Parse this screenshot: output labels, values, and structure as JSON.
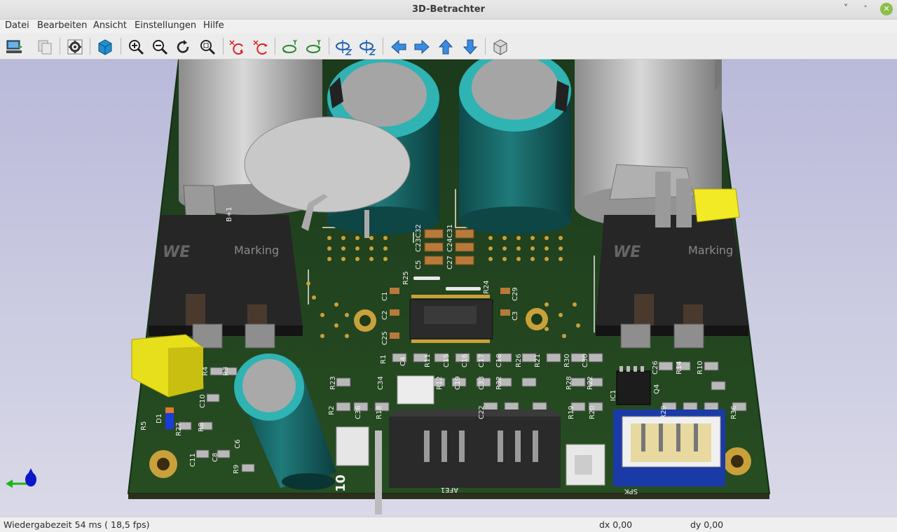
{
  "window": {
    "title": "3D-Betrachter"
  },
  "menu": [
    {
      "label": "Datei"
    },
    {
      "label": "Bearbeiten"
    },
    {
      "label": "Ansicht"
    },
    {
      "label": "Einstellungen"
    },
    {
      "label": "Hilfe"
    }
  ],
  "toolbar": {
    "buttons": [
      {
        "icon": "reload-board-icon"
      },
      {
        "icon": "copy-image-icon"
      },
      {
        "icon": "settings-gear-icon"
      },
      {
        "icon": "raytracing-cube-icon"
      },
      {
        "icon": "zoom-in-icon"
      },
      {
        "icon": "zoom-out-icon"
      },
      {
        "icon": "redraw-icon"
      },
      {
        "icon": "zoom-fit-icon"
      },
      {
        "icon": "rotate-x-cw-icon"
      },
      {
        "icon": "rotate-x-ccw-icon"
      },
      {
        "icon": "rotate-y-cw-icon"
      },
      {
        "icon": "rotate-y-ccw-icon"
      },
      {
        "icon": "rotate-z-cw-icon"
      },
      {
        "icon": "rotate-z-ccw-icon"
      },
      {
        "icon": "move-left-icon"
      },
      {
        "icon": "move-right-icon"
      },
      {
        "icon": "move-up-icon"
      },
      {
        "icon": "move-down-icon"
      },
      {
        "icon": "ortho-view-icon"
      }
    ]
  },
  "board_labels": {
    "marking_left": "Marking",
    "marking_right": "Marking",
    "silk_bp1": "B+1",
    "silk_c5": "C5",
    "silk_c23": "C23",
    "silk_c32": "C32",
    "silk_c27": "C27",
    "silk_c24": "C24",
    "silk_c31": "C31",
    "silk_r25": "R25",
    "silk_r24": "R24",
    "silk_c29": "C29",
    "silk_c1": "C1",
    "silk_c2": "C2",
    "silk_c3": "C3",
    "silk_c25": "C25",
    "silk_r1": "R1",
    "silk_c4": "C4",
    "silk_r11": "R11",
    "silk_c15": "C15",
    "silk_c16": "C16",
    "silk_c17": "C17",
    "silk_c18": "C18",
    "silk_r26": "R26",
    "silk_r21": "R21",
    "silk_r30": "R30",
    "silk_c30": "C30",
    "silk_c26": "C26",
    "silk_r14": "R14",
    "silk_r10": "R10",
    "silk_r4": "R4",
    "silk_r3": "R3",
    "silk_r23": "R23",
    "silk_c34": "C34",
    "silk_r12": "R12",
    "silk_c19": "C19",
    "silk_c33": "C33",
    "silk_r32": "R32",
    "silk_r28": "R28",
    "silk_r22": "R22",
    "silk_ic1": "IC1",
    "silk_q4": "Q4",
    "silk_c10": "C10",
    "silk_r2": "R2",
    "silk_c36": "C36",
    "silk_r18": "R18",
    "silk_c22": "C22",
    "silk_r19": "R19",
    "silk_r20": "R20",
    "silk_r29": "R29",
    "silk_r36": "R36",
    "silk_r5": "R5",
    "silk_d1": "D1",
    "silk_r27": "R27",
    "silk_r8": "R8",
    "silk_c11": "C11",
    "silk_c8": "C8",
    "silk_c6": "C6",
    "silk_r9": "R9",
    "silk_afe1": "AFE1",
    "silk_spk": "SPK",
    "silk_10": "10"
  },
  "status": {
    "render_time": "Wiedergabezeit 54 ms ( 18,5 fps)",
    "dx": "dx 0,00",
    "dy": "dy 0,00"
  }
}
